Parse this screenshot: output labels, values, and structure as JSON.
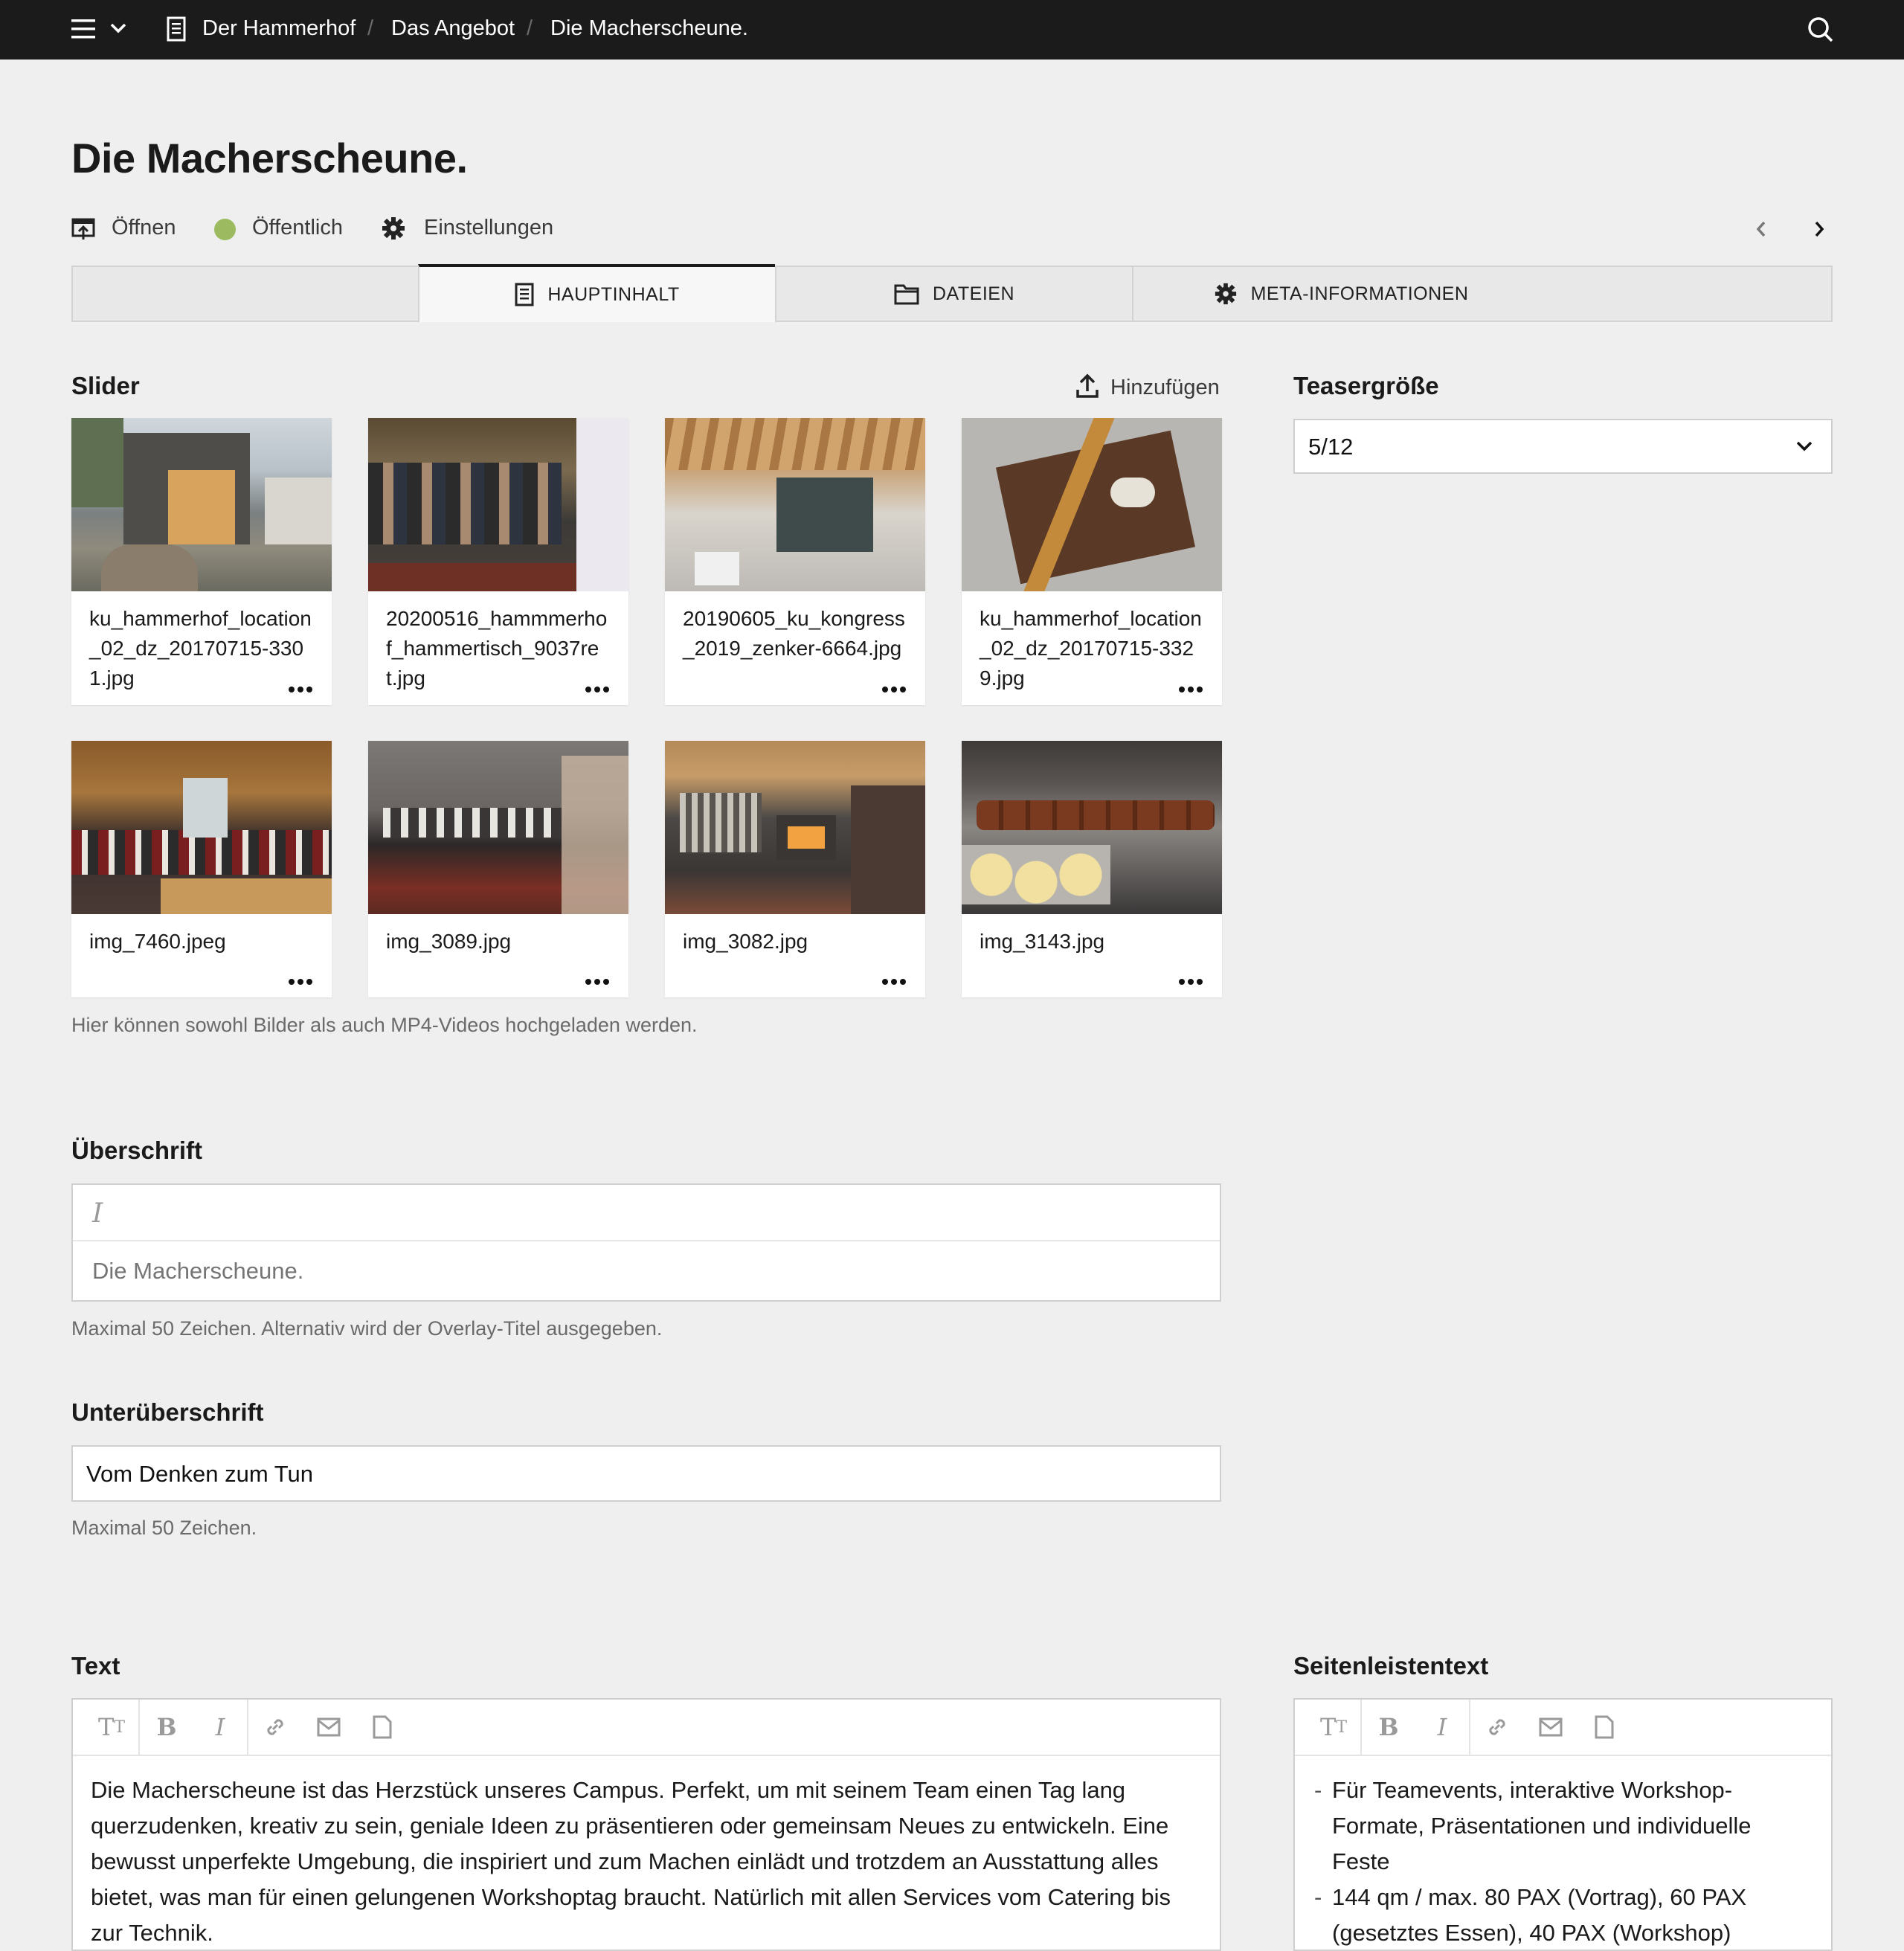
{
  "topbar": {
    "breadcrumbs": [
      "Der Hammerhof",
      "Das Angebot",
      "Die Macherscheune."
    ],
    "separator": "/"
  },
  "page": {
    "title": "Die Macherscheune.",
    "actions": {
      "open_label": "Öffnen",
      "status_label": "Öffentlich",
      "status_color": "#9cba5f",
      "settings_label": "Einstellungen"
    }
  },
  "tabs": [
    {
      "label": "HAUPTINHALT",
      "icon": "document-icon",
      "active": true
    },
    {
      "label": "DATEIEN",
      "icon": "folder-icon",
      "active": false
    },
    {
      "label": "META-INFORMATIONEN",
      "icon": "gear-icon",
      "active": false
    }
  ],
  "slider": {
    "label": "Slider",
    "add_label": "Hinzufügen",
    "hint": "Hier können sowohl Bilder als auch MP4-Videos hochgeladen werden.",
    "files": [
      {
        "name": "ku_hammerhof_location_02_dz_20170715-3301.jpg",
        "icon": "barn-exterior-photo"
      },
      {
        "name": "20200516_hammmerhof_hammertisch_9037ret.jpg",
        "icon": "audience-photo"
      },
      {
        "name": "20190605_ku_kongress_2019_zenker-6664.jpg",
        "icon": "hall-interior-photo"
      },
      {
        "name": "ku_hammerhof_location_02_dz_20170715-3329.jpg",
        "icon": "table-topview-photo"
      },
      {
        "name": "img_7460.jpeg",
        "icon": "dining-hall-photo"
      },
      {
        "name": "img_3089.jpg",
        "icon": "dinner-table-photo"
      },
      {
        "name": "img_3082.jpg",
        "icon": "lounge-fireplace-photo"
      },
      {
        "name": "img_3143.jpg",
        "icon": "buffet-photo"
      }
    ]
  },
  "teaser": {
    "label": "Teasergröße",
    "value": "5/12"
  },
  "heading": {
    "label": "Überschrift",
    "placeholder": "Die Macherscheune.",
    "hint": "Maximal 50 Zeichen. Alternativ wird der Overlay-Titel ausgegeben."
  },
  "subheading": {
    "label": "Unterüberschrift",
    "value": "Vom Denken zum Tun",
    "hint": "Maximal 50 Zeichen."
  },
  "text": {
    "label": "Text",
    "body": "Die Macherscheune ist das Herzstück unseres Campus. Perfekt, um mit seinem Team einen Tag lang querzudenken, kreativ zu sein, geniale Ideen zu präsentieren oder gemeinsam Neues zu entwickeln. Eine bewusst unperfekte Umgebung, die inspiriert und zum Machen einlädt und trotzdem an Ausstattung alles bietet, was man für einen gelungenen Workshoptag braucht. Natürlich mit allen Services vom Catering bis zur Technik."
  },
  "sidebar_text": {
    "label": "Seitenleistentext",
    "items": [
      "Für Teamevents, interaktive Workshop-Formate,  Präsentationen und individuelle Feste",
      "144 qm / max. 80 PAX (Vortrag), 60 PAX (gesetztes Essen), 40 PAX (Workshop)"
    ]
  },
  "toolbar_icons": [
    "text-style-icon",
    "bold-icon",
    "italic-icon",
    "link-icon",
    "email-icon",
    "file-icon"
  ]
}
